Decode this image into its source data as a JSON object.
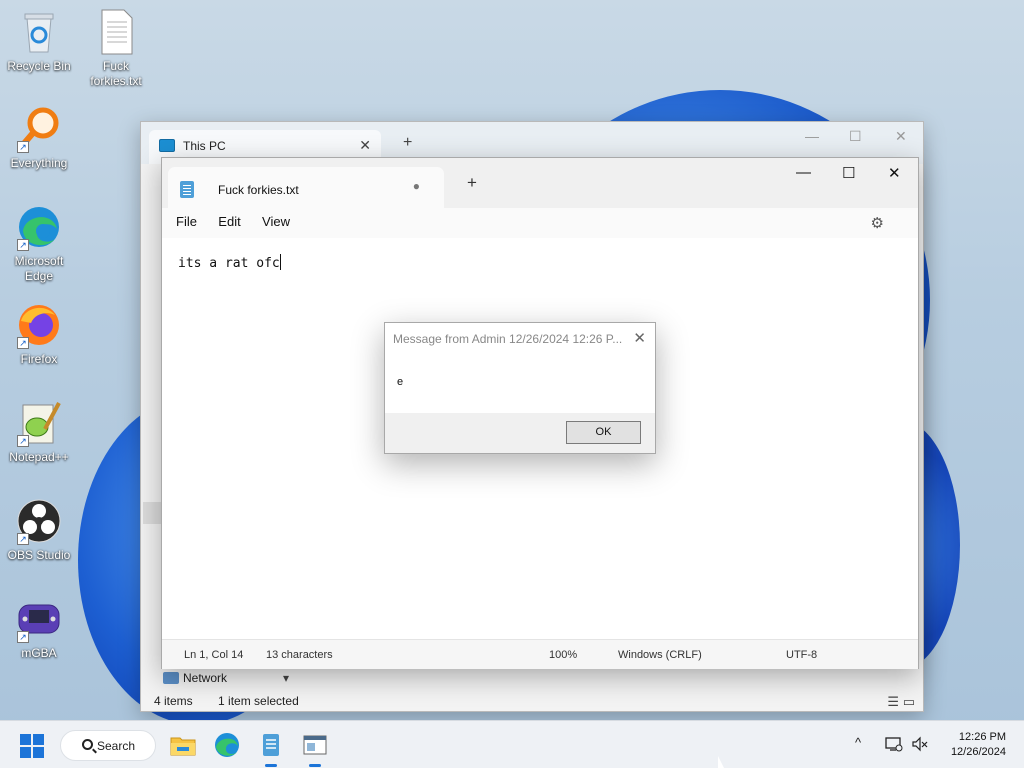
{
  "desktop": {
    "icons": [
      {
        "label": "Recycle Bin",
        "icon": "recycle-bin-icon"
      },
      {
        "label": "Fuck forkies.txt",
        "icon": "text-file-icon"
      },
      {
        "label": "Everything",
        "icon": "everything-search-icon"
      },
      {
        "label": "Microsoft Edge",
        "icon": "edge-icon"
      },
      {
        "label": "Firefox",
        "icon": "firefox-icon"
      },
      {
        "label": "Notepad++",
        "icon": "notepadpp-icon"
      },
      {
        "label": "OBS Studio",
        "icon": "obs-icon"
      },
      {
        "label": "mGBA",
        "icon": "mgba-icon"
      }
    ],
    "shortcut_arrow": "↗"
  },
  "explorer": {
    "tab_title": "This PC",
    "close_glyph": "✕",
    "new_tab_glyph": "+",
    "controls": {
      "minimize": "—",
      "maximize": "☐",
      "close": "✕"
    },
    "nav_network": "Network",
    "status": {
      "items": "4 items",
      "selected": "1 item selected"
    }
  },
  "notepad": {
    "tab_title": "Fuck forkies.txt",
    "unsaved_dot": "●",
    "new_tab_glyph": "+",
    "controls": {
      "minimize": "—",
      "maximize": "☐",
      "close": "✕"
    },
    "menu": {
      "file": "File",
      "edit": "Edit",
      "view": "View"
    },
    "settings_glyph": "⚙",
    "content": "its a rat ofc",
    "status": {
      "position": "Ln 1, Col 14",
      "characters": "13 characters",
      "zoom": "100%",
      "line_ending": "Windows (CRLF)",
      "encoding": "UTF-8"
    }
  },
  "dialog": {
    "title": "Message from Admin 12/26/2024 12:26 P...",
    "close_glyph": "✕",
    "message": "e",
    "ok_label": "OK"
  },
  "taskbar": {
    "search_label": "Search",
    "apps": [
      "file-explorer-icon",
      "edge-icon",
      "notepad-icon",
      "messaging-app-icon"
    ],
    "tray_chevron": "^",
    "clock": {
      "time": "12:26 PM",
      "date": "12/26/2024"
    }
  },
  "colors": {
    "accent": "#1c74d8",
    "wallpaper": "#b7cde0"
  }
}
